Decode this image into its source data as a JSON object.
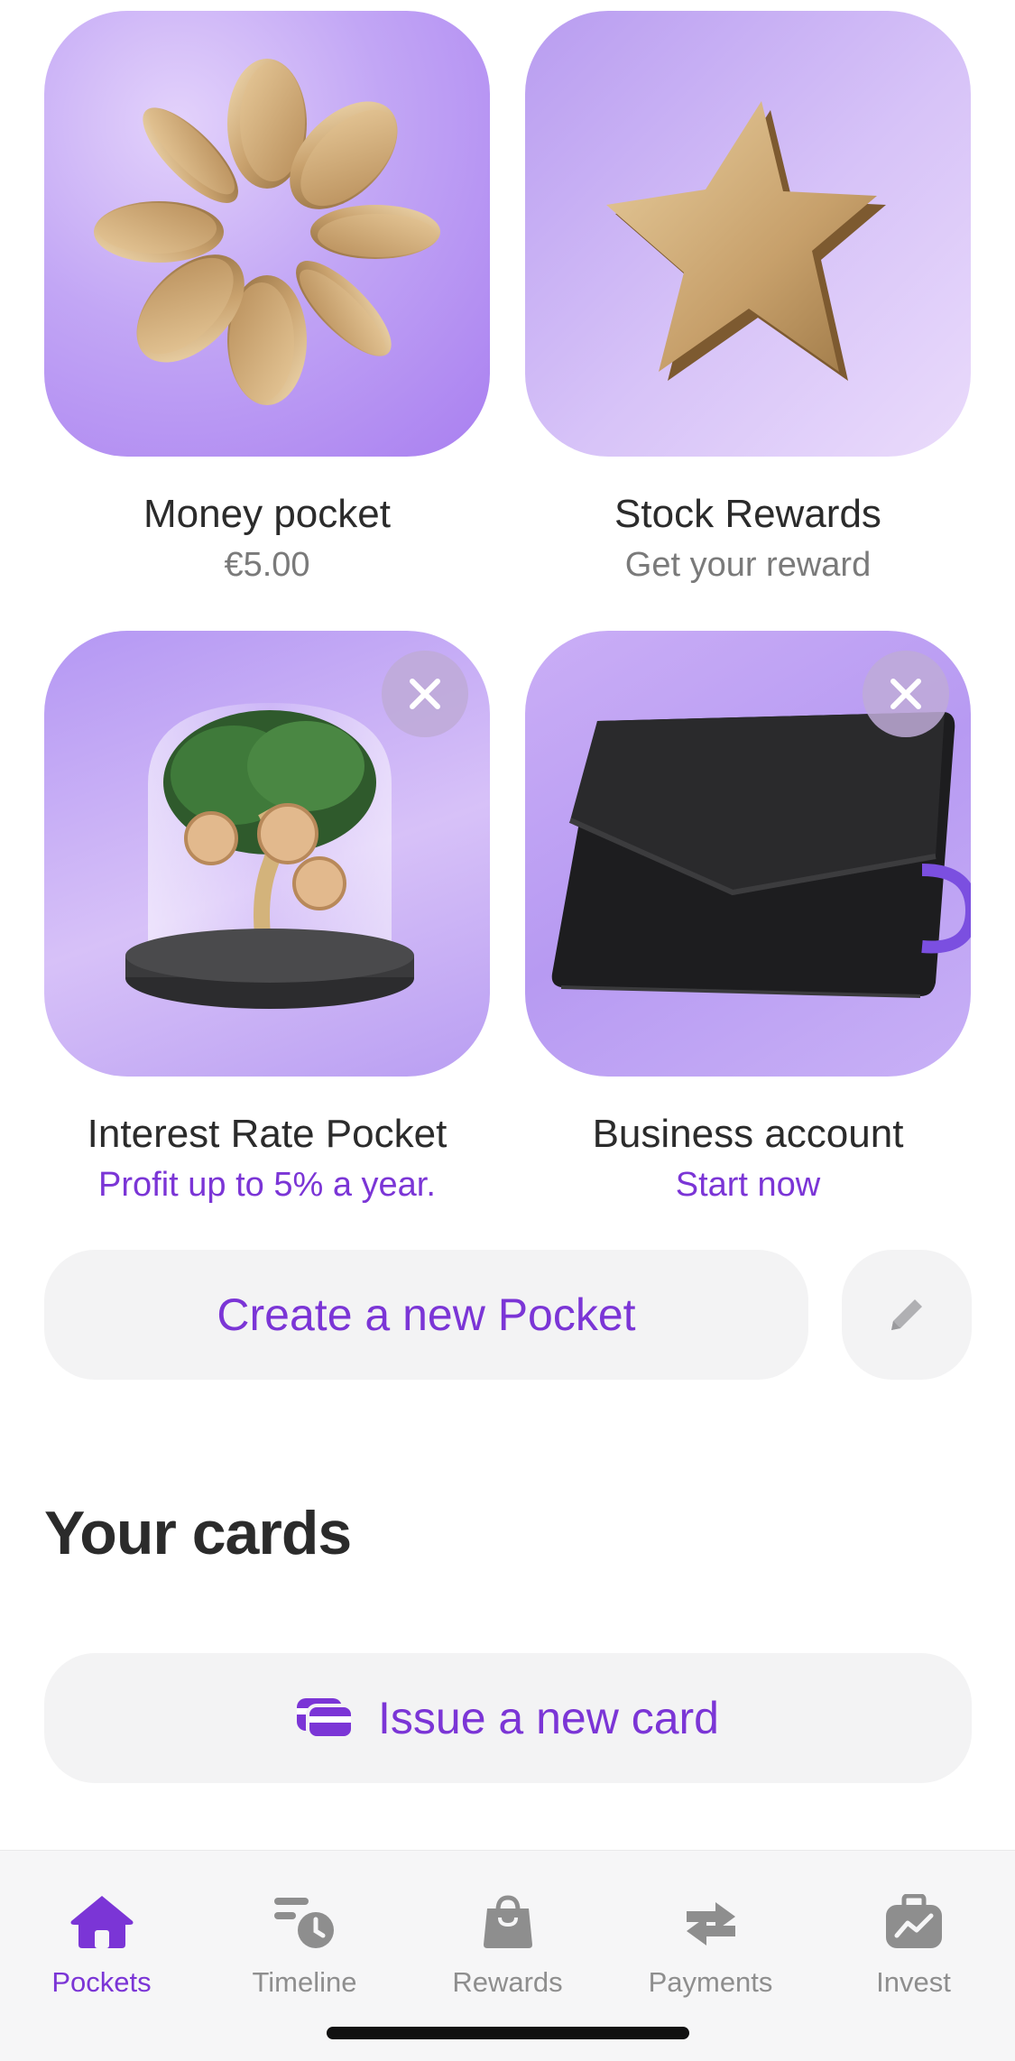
{
  "pockets": [
    {
      "title": "Money pocket",
      "subtitle": "€5.00"
    },
    {
      "title": "Stock Rewards",
      "subtitle": "Get your reward"
    },
    {
      "title": "Interest Rate Pocket",
      "subtitle": "Profit up to 5% a year."
    },
    {
      "title": "Business account",
      "subtitle": "Start now"
    }
  ],
  "actions": {
    "create_pocket": "Create a new Pocket",
    "edit_icon": "pencil-icon"
  },
  "cards_section": {
    "title": "Your cards",
    "issue_card": "Issue a new card",
    "issue_icon": "cards-icon"
  },
  "tabbar": {
    "tabs": [
      {
        "label": "Pockets",
        "icon": "home-icon",
        "active": true
      },
      {
        "label": "Timeline",
        "icon": "timeline-icon",
        "active": false
      },
      {
        "label": "Rewards",
        "icon": "shopping-bag-icon",
        "active": false
      },
      {
        "label": "Payments",
        "icon": "transfer-arrows-icon",
        "active": false
      },
      {
        "label": "Invest",
        "icon": "briefcase-chart-icon",
        "active": false
      }
    ]
  },
  "colors": {
    "accent": "#7b35d6",
    "tile_purple": "#b497f3",
    "button_bg": "#f3f3f4",
    "muted_text": "#7a7a7a"
  }
}
